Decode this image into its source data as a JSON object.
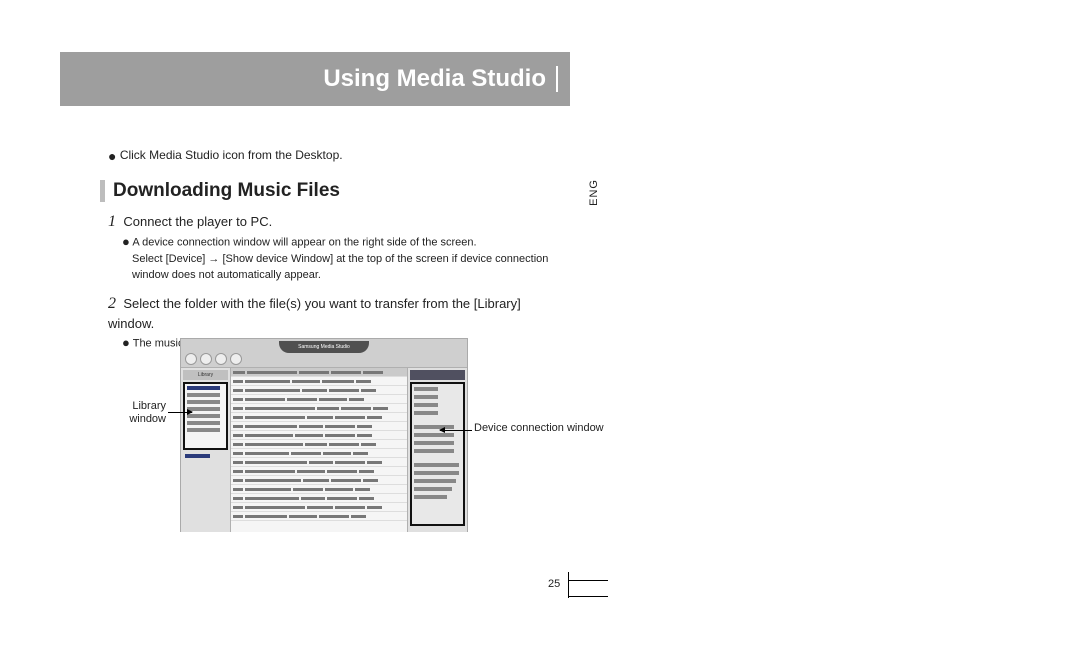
{
  "header": {
    "title": "Using Media Studio"
  },
  "lang_tab": "ENG",
  "intro_bullet": "Click Media Studio icon from the Desktop.",
  "section_title": "Downloading Music Files",
  "steps": [
    {
      "num": "1",
      "text": "Connect the player to PC.",
      "sub": [
        "A device connection window will appear on the right side of the screen.",
        "Select [Device] → [Show device Window] at the top of the screen if device connection window does not automatically appear."
      ]
    },
    {
      "num": "2",
      "text": "Select the folder with the file(s) you want to transfer from the [Library] window.",
      "sub": [
        "The music files within the folder appear on the center of the screen."
      ]
    }
  ],
  "callouts": {
    "library": "Library window",
    "device": "Device connection window"
  },
  "screenshot": {
    "app_title": "Samsung Media Studio",
    "library_header": "Library"
  },
  "page_number": "25"
}
